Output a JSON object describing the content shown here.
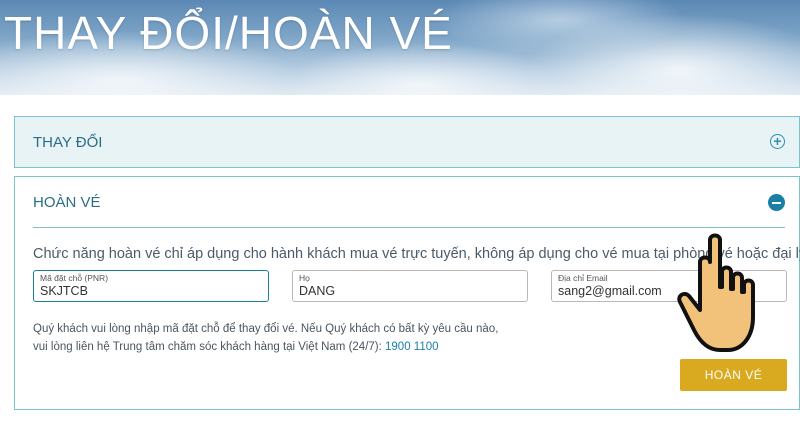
{
  "header": {
    "title": "THAY ĐỔI/HOÀN VÉ"
  },
  "sections": {
    "change": {
      "label": "THAY ĐỔI",
      "toggle_icon": "plus-circle-icon",
      "expanded": false
    },
    "refund": {
      "label": "HOÀN VÉ",
      "toggle_icon": "minus-circle-icon",
      "expanded": true,
      "notice": "Chức năng hoàn vé chỉ áp dụng cho hành khách mua vé trực tuyến, không áp dụng cho vé mua tại phòng vé hoặc đại lý.",
      "fields": {
        "pnr": {
          "label": "Mã đặt chỗ (PNR)",
          "value": "SKJTCB"
        },
        "last_name": {
          "label": "Họ",
          "value": "DANG"
        },
        "email": {
          "label": "Địa chỉ Email",
          "value": "sang2@gmail.com"
        }
      },
      "help_line1": "Quý khách vui lòng nhập mã đặt chỗ để thay đổi vé. Nếu Quý khách có bất kỳ yêu cầu nào,",
      "help_line2": "vui lòng liên hệ Trung tâm chăm sóc khách hàng tại Việt Nam (24/7): ",
      "phone": "1900 1100",
      "submit_label": "HOÀN VÉ"
    }
  },
  "colors": {
    "accent": "#1a7fa6",
    "border": "#7dc3cd",
    "button": "#d9a91f",
    "cursor": "#f2c27a"
  },
  "cursor_icon": "pointing-hand-icon"
}
